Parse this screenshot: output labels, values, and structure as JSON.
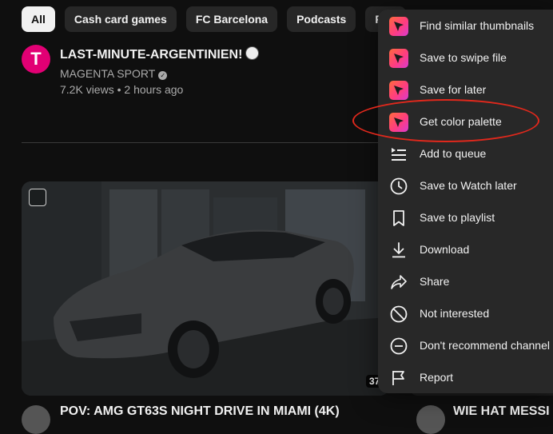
{
  "chips": [
    "All",
    "Cash card games",
    "FC Barcelona",
    "Podcasts",
    "FC I"
  ],
  "top_video": {
    "avatar_letter": "T",
    "title": "LAST-MINUTE-ARGENTINIEN!",
    "channel": "MAGENTA SPORT",
    "views": "7.2K views",
    "separator": "•",
    "age": "2 hours ago"
  },
  "thumbnail": {
    "duration": "37"
  },
  "bottom": {
    "left_title": "POV: AMG GT63S NIGHT DRIVE IN MIAMI (4K)",
    "right_title": "WIE HAT MESSI"
  },
  "menu": {
    "items": [
      {
        "label": "Find similar thumbnails",
        "icon": "extension-icon"
      },
      {
        "label": "Save to swipe file",
        "icon": "extension-icon"
      },
      {
        "label": "Save for later",
        "icon": "extension-icon"
      },
      {
        "label": "Get color palette",
        "icon": "extension-icon"
      },
      {
        "label": "Add to queue",
        "icon": "queue-icon"
      },
      {
        "label": "Save to Watch later",
        "icon": "clock-icon"
      },
      {
        "label": "Save to playlist",
        "icon": "bookmark-icon"
      },
      {
        "label": "Download",
        "icon": "download-icon"
      },
      {
        "label": "Share",
        "icon": "share-icon"
      },
      {
        "label": "Not interested",
        "icon": "block-icon"
      },
      {
        "label": "Don't recommend channel",
        "icon": "minus-circle-icon"
      },
      {
        "label": "Report",
        "icon": "flag-icon"
      }
    ]
  },
  "colors": {
    "background": "#0f0f0f",
    "menu_background": "#282828",
    "highlight_ring": "#e0281c",
    "telekom_magenta": "#e20074"
  }
}
